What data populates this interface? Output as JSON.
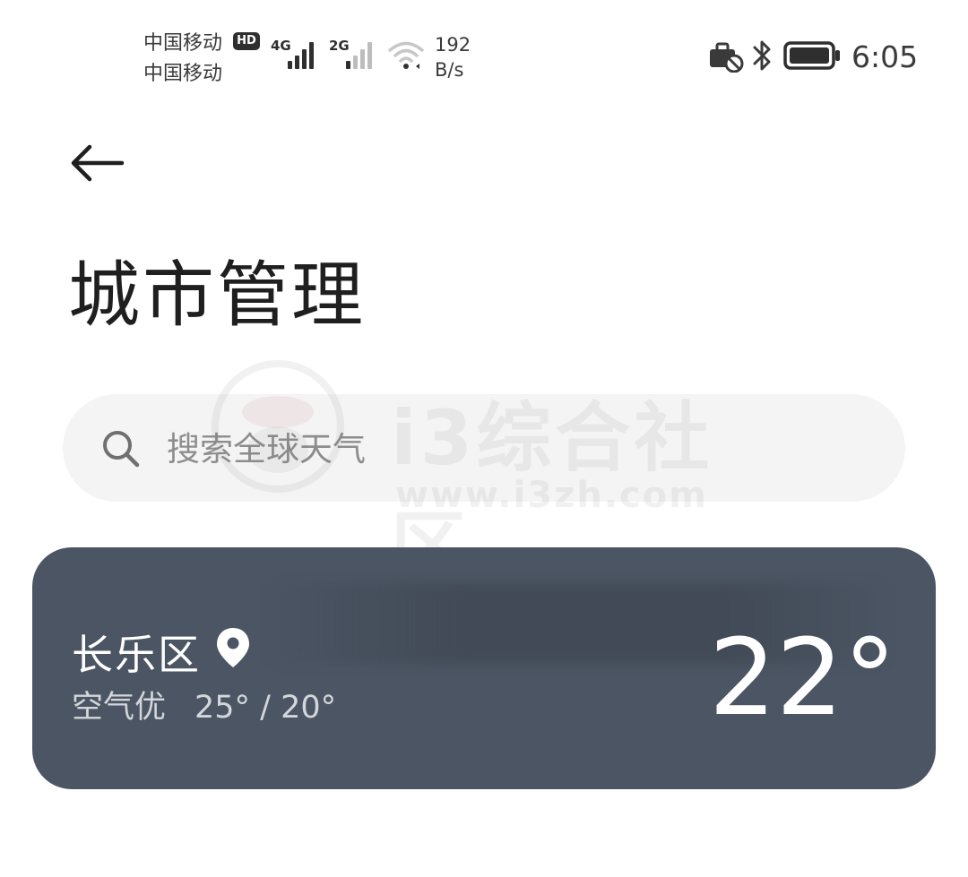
{
  "status_bar": {
    "carrier_1": "中国移动",
    "carrier_2": "中国移动",
    "hd_label": "HD",
    "net_1": "4G",
    "net_2": "2G",
    "speed_value": "192",
    "speed_unit": "B/s",
    "time": "6:05",
    "icons": [
      "briefcase-disabled-icon",
      "bluetooth-icon",
      "battery-icon"
    ]
  },
  "header": {
    "back_icon": "back-arrow-icon",
    "title": "城市管理"
  },
  "search": {
    "placeholder": "搜索全球天气",
    "icon": "search-icon"
  },
  "watermark": {
    "text": "i3综合社区",
    "url": "www.i3zh.com"
  },
  "city_card": {
    "name": "长乐区",
    "location_icon": "location-pin-icon",
    "air_quality": "空气优",
    "temp_range": "25° / 20°",
    "current_temp": "22°",
    "background_color": "#4b5563"
  }
}
